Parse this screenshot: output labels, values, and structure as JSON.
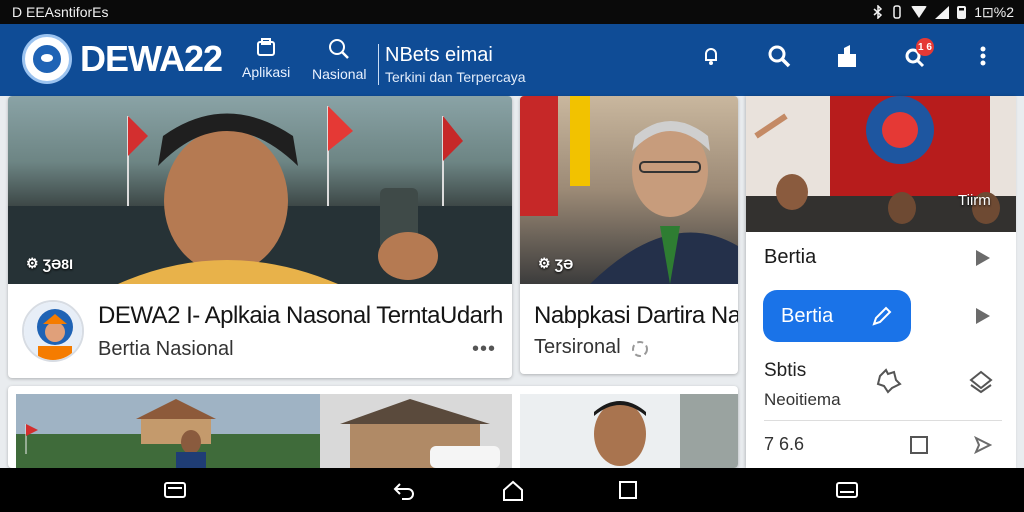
{
  "status_bar": {
    "left_text": "D EEAsntiforEs",
    "battery": "1⊡%2"
  },
  "app_bar": {
    "brand": "DEWA22",
    "tabs": [
      {
        "label": "Aplikasi",
        "icon": "apps-icon"
      },
      {
        "label": "Nasional",
        "icon": "search-icon"
      }
    ],
    "tagline_title": "NBets eimai",
    "tagline_sub": "Terkini dan Terpercaya",
    "actions": [
      {
        "icon": "notification-icon"
      },
      {
        "icon": "search-icon"
      },
      {
        "icon": "share-icon"
      },
      {
        "icon": "alert-search-icon",
        "badge": "1 6"
      },
      {
        "icon": "more-vert-icon"
      }
    ],
    "colors": {
      "primary": "#0f4c96",
      "accent": "#1a73e8",
      "badge": "#e53935"
    }
  },
  "feed": {
    "card1": {
      "photo_caption": "ƷƏ8I",
      "headline": "DEWA2 I- Aplkaia Nasonal TerntaUdarh",
      "subtitle": "Bertia Nasional",
      "more": "•••"
    },
    "card2": {
      "photo_caption": "ƷƏ",
      "headline": "Nabpkasi Dartira Na",
      "subtitle": "Tersironal"
    }
  },
  "panel": {
    "photo_caption": "Tiirm",
    "row1_label": "Bertia",
    "button_label": "Bertia",
    "row3_title": "Sbtis",
    "row3_sub": "Neoitiema",
    "row4_label": "7 6.6"
  }
}
